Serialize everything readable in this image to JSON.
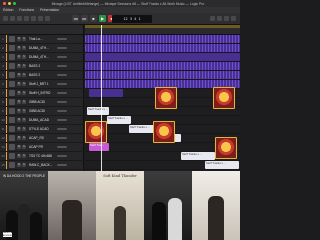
{
  "window": {
    "title": "Mixage (LIST Untitled/Mélange) — Mixtape Sessions #8 — Stuff Tracks x All Work Music — Logic Pro",
    "traffic_colors": [
      "#ff5f57",
      "#febc2e",
      "#28c840"
    ]
  },
  "menubar": {
    "items": [
      "Édition",
      "Fonctions",
      "Présentation"
    ]
  },
  "control_bar": {
    "lcd": "12 3 4 1",
    "transport": [
      "◂◂",
      "▸▸",
      "■",
      "▶",
      "●",
      "⟲"
    ]
  },
  "tracks": [
    {
      "name": "That La...",
      "color": "#e9a23b"
    },
    {
      "name": "DUMA_4TH...",
      "color": "#e9a23b"
    },
    {
      "name": "DUMA_4TH...",
      "color": "#e9a23b"
    },
    {
      "name": "BASS 2",
      "color": "#e9a23b"
    },
    {
      "name": "BASS 2",
      "color": "#e9a23b"
    },
    {
      "name": "Stuff J_BRT 1",
      "color": "#e9a23b"
    },
    {
      "name": "Stuff H_INTRO",
      "color": "#e9a23b"
    },
    {
      "name": "GIBB ACID",
      "color": "#e9a23b"
    },
    {
      "name": "GIBB ACID",
      "color": "#e9a23b"
    },
    {
      "name": "DUMA_ACAD",
      "color": "#e9a23b"
    },
    {
      "name": "STYLE ACAD",
      "color": "#e9a23b"
    },
    {
      "name": "ACAP_RS",
      "color": "#e9a23b"
    },
    {
      "name": "ACAP PR",
      "color": "#e9a23b"
    },
    {
      "name": "TSS TC 4th 688",
      "color": "#e9a23b"
    },
    {
      "name": "RAW.C_BACK...",
      "color": "#e9a23b"
    }
  ],
  "regions": {
    "audio_label": "Stuff Tracks x",
    "white_label": "Stuff Tracks x ...",
    "pink_label": "Stuff Trac..."
  },
  "albums": [
    {
      "title": "IN DA HOOD 2 THE PEOPLE"
    },
    {
      "title": ""
    },
    {
      "title": "Soft Kind Thunder"
    },
    {
      "title": ""
    },
    {
      "title": ""
    }
  ],
  "parental_advisory": "PARENTAL ADVISORY"
}
